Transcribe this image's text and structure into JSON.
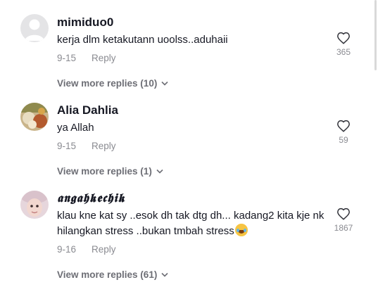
{
  "comments": [
    {
      "username": "mimiduo0",
      "text": "kerja dlm ketakutann uoolss..aduhaii",
      "date": "9-15",
      "reply_label": "Reply",
      "likes": "365",
      "more_replies": "View more replies (10)",
      "avatar_icon": "default-avatar-icon"
    },
    {
      "username": "Alia Dahlia",
      "text": "ya Allah",
      "date": "9-15",
      "reply_label": "Reply",
      "likes": "59",
      "more_replies": "View more replies (1)",
      "avatar_icon": "photo-avatar-icon"
    },
    {
      "username": "𝖆𝖓𝖌𝖆𝖍𝖐𝖊𝖈𝖍𝖎𝖐",
      "text": "klau kne kat sy ..esok dh tak dtg dh... kadang2 kita kje nk hilangkan stress ..bukan tmbah stress",
      "text_emoji": "laughing-tears-emoji",
      "date": "9-16",
      "reply_label": "Reply",
      "likes": "1867",
      "more_replies": "View more replies (61)",
      "avatar_icon": "photo-avatar-icon"
    }
  ],
  "colors": {
    "primary_text": "#161823",
    "secondary_text": "#8a8b91",
    "view_more_text": "#6d6e75",
    "background": "#ffffff"
  }
}
